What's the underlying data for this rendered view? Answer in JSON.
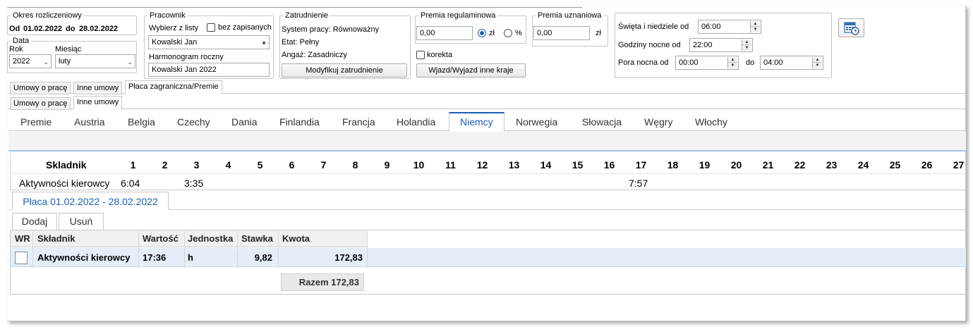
{
  "period": {
    "legend": "Okres rozliczeniowy",
    "from_label": "Od",
    "from": "01.02.2022",
    "to_label": "do",
    "to": "28.02.2022"
  },
  "date_group": {
    "legend": "Data",
    "year_label": "Rok",
    "year_value": "2022",
    "month_label": "Miesiąc",
    "month_value": "luty"
  },
  "employee": {
    "legend": "Pracownik",
    "choose_label": "Wybierz z listy",
    "unsaved_label": "bez zapisanych",
    "selected": "Kowalski Jan",
    "schedule_label": "Harmonogram roczny",
    "schedule_value": "Kowalski Jan 2022"
  },
  "employment": {
    "legend": "Zatrudnienie",
    "work_system": "System pracy: Równoważny",
    "etat": "Etat: Pełny",
    "engagement": "Angaż: Zasadniczy",
    "modify_button": "Modyfikuj zatrudnienie"
  },
  "bonus_regular": {
    "legend": "Premia regulaminowa",
    "value": "0,00",
    "unit_zl": "zł",
    "unit_pct": "%",
    "selected_unit": "zł",
    "correction_label": "korekta",
    "trip_button": "Wjazd/Wyjazd inne kraje"
  },
  "bonus_discretionary": {
    "legend": "Premia uznaniowa",
    "value": "0,00",
    "unit": "zł"
  },
  "times": {
    "holidays_label": "Święta i niedziele od",
    "holidays_value": "06:00",
    "night_hours_label": "Godziny nocne od",
    "night_hours_value": "22:00",
    "night_time_label": "Pora nocna od",
    "night_time_from": "00:00",
    "night_time_to_label": "do",
    "night_time_to": "04:00"
  },
  "tabs_row1": [
    "Umowy o pracę",
    "Inne umowy",
    "Płaca zagraniczna/Premie"
  ],
  "tabs_row2": [
    "Umowy o pracę",
    "Inne umowy"
  ],
  "country_tabs": [
    "Premie",
    "Austria",
    "Belgia",
    "Czechy",
    "Dania",
    "Finlandia",
    "Francja",
    "Holandia",
    "Niemcy",
    "Norwegia",
    "Słowacja",
    "Węgry",
    "Włochy"
  ],
  "active_country": "Niemcy",
  "day_grid": {
    "component_header": "Skladnik",
    "days": [
      "1",
      "2",
      "3",
      "4",
      "5",
      "6",
      "7",
      "8",
      "9",
      "10",
      "11",
      "12",
      "13",
      "14",
      "15",
      "16",
      "17",
      "18",
      "19",
      "20",
      "21",
      "22",
      "23",
      "24",
      "25",
      "26",
      "27"
    ],
    "row_label": "Aktywności kierowcy",
    "day1_value": "6:04",
    "day3_value": "3:35",
    "day17_value": "7:57"
  },
  "payroll_tab": "Płaca 01.02.2022 - 28.02.2022",
  "actions": {
    "add": "Dodaj",
    "remove": "Usuń"
  },
  "payroll_table": {
    "headers": {
      "wr": "WR",
      "component": "Składnik",
      "value": "Wartość",
      "unit": "Jednostka",
      "rate": "Stawka",
      "amount": "Kwota"
    },
    "row": {
      "component": "Aktywności kierowcy",
      "value": "17:36",
      "unit": "h",
      "rate": "9,82",
      "amount": "172,83"
    },
    "total": "Razem 172,83"
  },
  "colors": {
    "accent": "#1a5fb4",
    "selected_row": "#e3eef8",
    "header_bg": "#f0f0f0"
  }
}
